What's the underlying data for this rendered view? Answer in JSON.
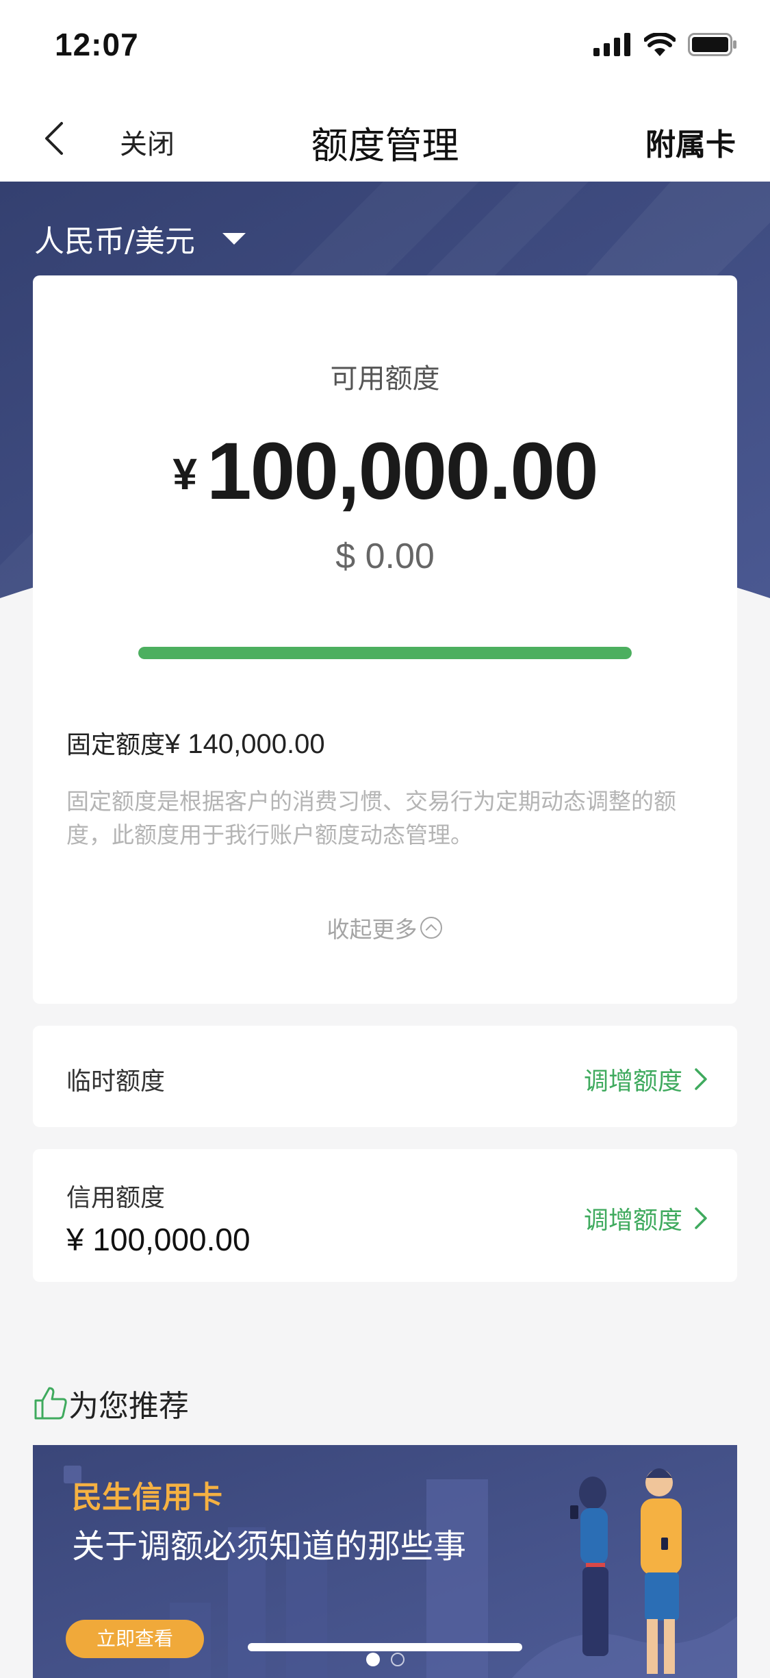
{
  "status_bar": {
    "time": "12:07"
  },
  "nav": {
    "close_label": "关闭",
    "title": "额度管理",
    "right_label": "附属卡"
  },
  "hero": {
    "currency_selector": "人民币/美元"
  },
  "available": {
    "label": "可用额度",
    "rmb_symbol": "¥",
    "rmb_amount": "100,000.00",
    "usd_amount": "$ 0.00",
    "progress_fraction": 1.0,
    "progress_color": "#4caf5f"
  },
  "fixed": {
    "label": "固定额度",
    "amount": "¥ 140,000.00",
    "description": "固定额度是根据客户的消费习惯、交易行为定期动态调整的额度，此额度用于我行账户额度动态管理。",
    "collapse_label": "收起更多"
  },
  "temporary": {
    "label": "临时额度",
    "action": "调增额度"
  },
  "credit": {
    "label": "信用额度",
    "amount": "¥ 100,000.00",
    "action": "调增额度"
  },
  "recommend": {
    "title": "为您推荐",
    "banner": {
      "brand": "民生信用卡",
      "headline": "关于调额必须知道的那些事",
      "button": "立即查看"
    }
  },
  "carousel": {
    "count": 2,
    "active": 0
  },
  "colors": {
    "hero_bg": "#3a4578",
    "accent_green": "#3faa5e",
    "banner_orange": "#f0a93a"
  }
}
